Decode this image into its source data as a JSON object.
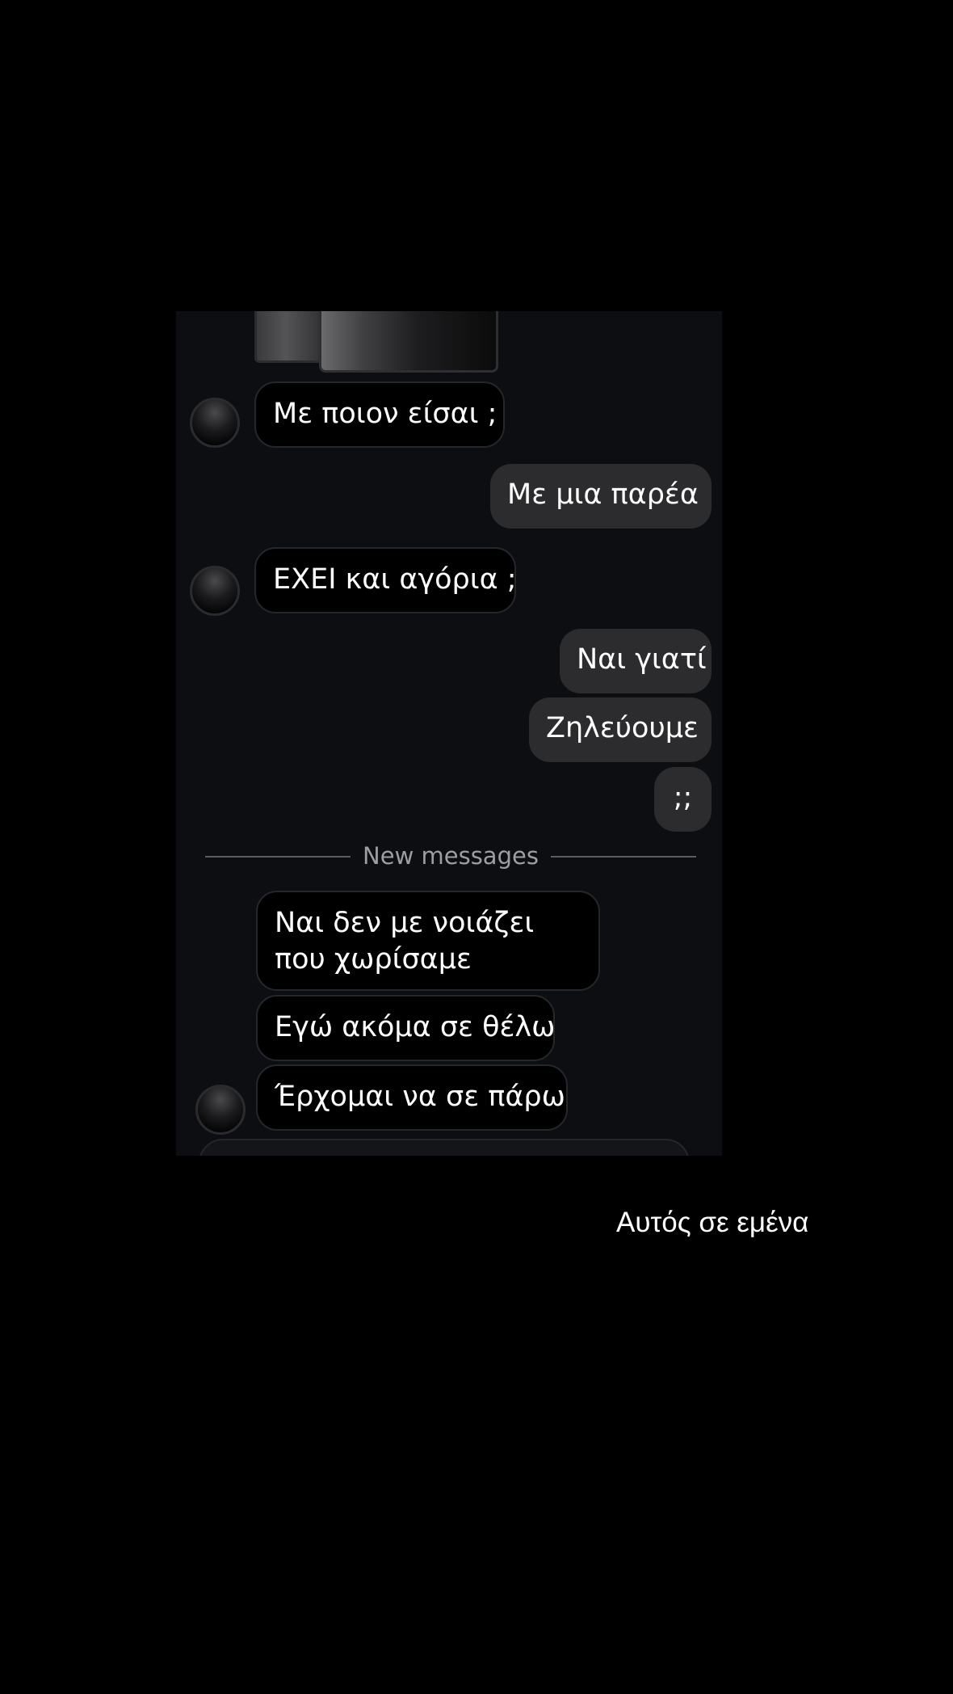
{
  "messages": [
    {
      "direction": "incoming",
      "text": "Με ποιον είσαι ;"
    },
    {
      "direction": "outgoing",
      "text": "Με μια παρέα"
    },
    {
      "direction": "incoming",
      "text": "ΕΧΕΙ και αγόρια ;"
    },
    {
      "direction": "outgoing",
      "text": "Ναι γιατί"
    },
    {
      "direction": "outgoing",
      "text": "Ζηλεύουμε"
    },
    {
      "direction": "outgoing",
      "text": ";;"
    }
  ],
  "divider": {
    "label": "New messages"
  },
  "new_messages": [
    {
      "direction": "incoming",
      "text": "Ναι δεν με νοιάζει που χωρίσαμε"
    },
    {
      "direction": "incoming",
      "text": "Εγώ ακόμα σε θέλω"
    },
    {
      "direction": "incoming",
      "text": "Έρχομαι να σε πάρω"
    }
  ],
  "caption": "Αυτός σε εμένα",
  "colors": {
    "background": "#000000",
    "chat_background": "#0c0e12",
    "incoming_bubble": "#000000",
    "outgoing_bubble": "#2c2c2e",
    "text": "#ffffff",
    "divider_text": "#9c9ea4"
  }
}
